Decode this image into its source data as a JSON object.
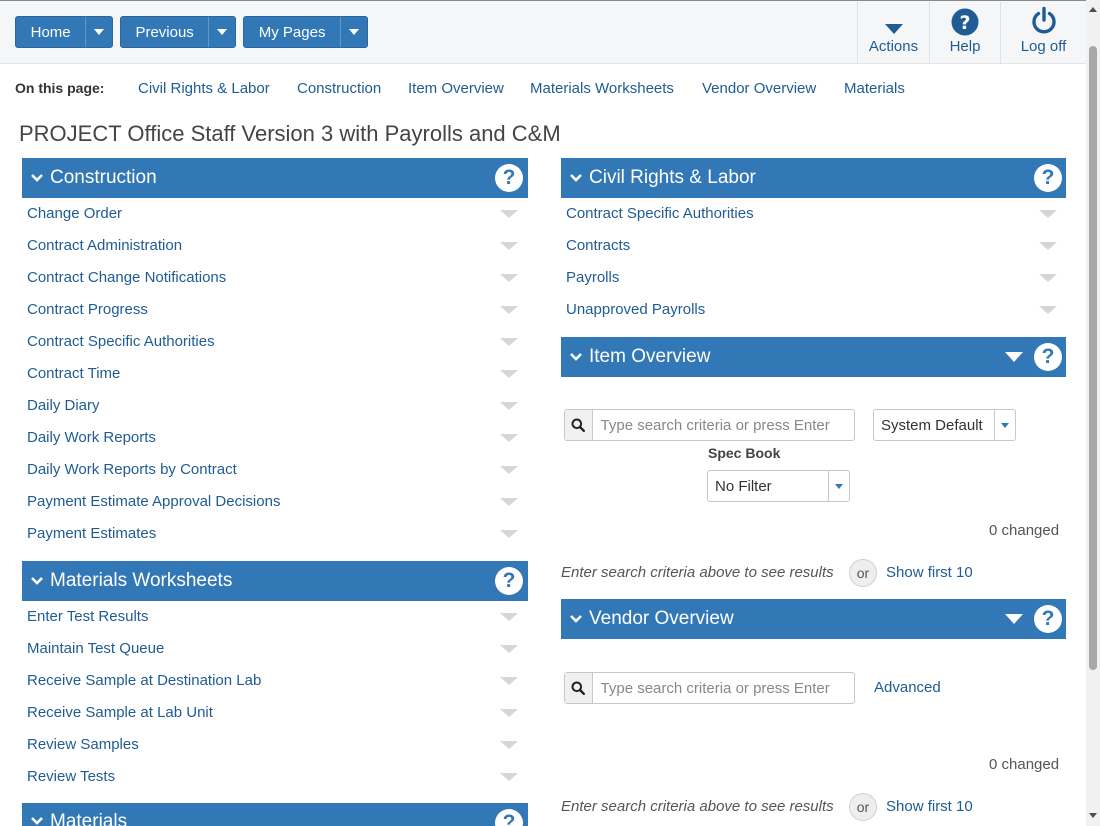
{
  "toolbar": {
    "home_label": "Home",
    "previous_label": "Previous",
    "mypages_label": "My Pages",
    "actions_label": "Actions",
    "help_label": "Help",
    "logoff_label": "Log off"
  },
  "on_this_page": {
    "label": "On this page:",
    "links": [
      "Civil Rights & Labor",
      "Construction",
      "Item Overview",
      "Materials Worksheets",
      "Vendor Overview",
      "Materials"
    ]
  },
  "page_title": "PROJECT Office Staff Version 3 with Payrolls and C&M",
  "construction": {
    "title": "Construction",
    "items": [
      "Change Order",
      "Contract Administration",
      "Contract Change Notifications",
      "Contract Progress",
      "Contract Specific Authorities",
      "Contract Time",
      "Daily Diary",
      "Daily Work Reports",
      "Daily Work Reports by Contract",
      "Payment Estimate Approval Decisions",
      "Payment Estimates"
    ]
  },
  "materials_worksheets": {
    "title": "Materials Worksheets",
    "items": [
      "Enter Test Results",
      "Maintain Test Queue",
      "Receive Sample at Destination Lab",
      "Receive Sample at Lab Unit",
      "Review Samples",
      "Review Tests"
    ]
  },
  "materials": {
    "title": "Materials"
  },
  "civil_rights": {
    "title": "Civil Rights & Labor",
    "items": [
      "Contract Specific Authorities",
      "Contracts",
      "Payrolls",
      "Unapproved Payrolls"
    ]
  },
  "item_overview": {
    "title": "Item Overview",
    "search_placeholder": "Type search criteria or press Enter",
    "view_select": "System Default",
    "spec_book_label": "Spec Book",
    "spec_book_value": "No Filter",
    "changed": "0 changed",
    "hint": "Enter search criteria above to see results",
    "or": "or",
    "show_first": "Show first 10"
  },
  "vendor_overview": {
    "title": "Vendor Overview",
    "search_placeholder": "Type search criteria or press Enter",
    "advanced": "Advanced",
    "changed": "0 changed",
    "hint": "Enter search criteria above to see results",
    "or": "or",
    "show_first": "Show first 10"
  },
  "icons": {
    "help": "question-circle-icon",
    "collapse": "chevron-down-icon",
    "row_menu": "triangle-down-icon",
    "search": "search-icon",
    "logoff": "power-icon"
  },
  "colors": {
    "header_blue": "#3278b7",
    "link_blue": "#1f5c94"
  }
}
